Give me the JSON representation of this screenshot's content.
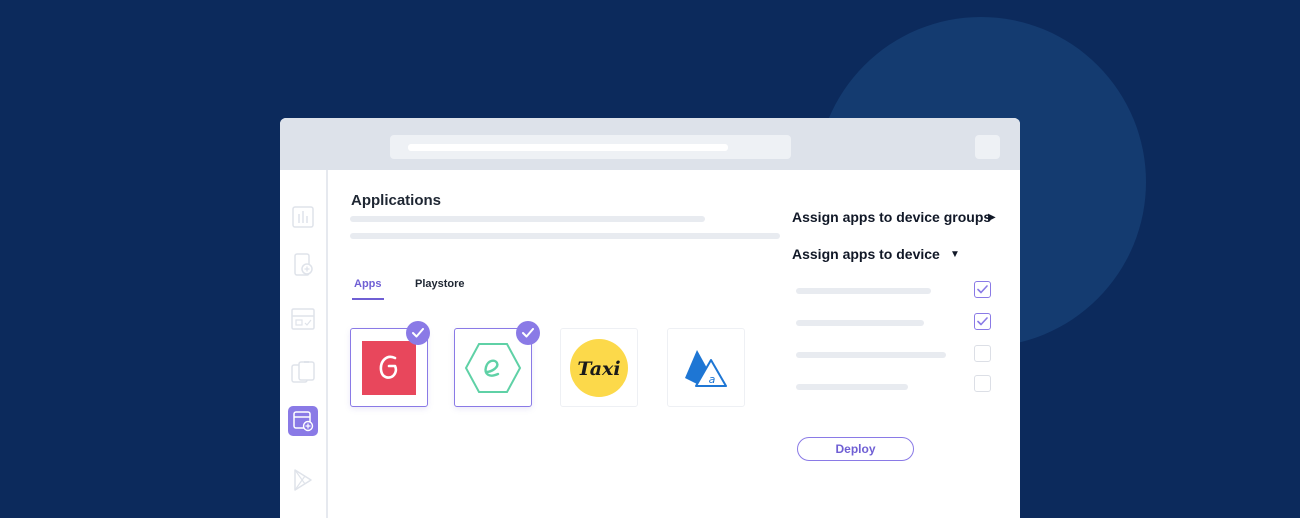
{
  "main": {
    "title": "Applications",
    "tabs": [
      {
        "label": "Apps",
        "active": true
      },
      {
        "label": "Playstore",
        "active": false
      }
    ],
    "apps": [
      {
        "name": "g-app-logo",
        "letter": "G",
        "selected": true
      },
      {
        "name": "e-app-logo",
        "letter": "e",
        "selected": true
      },
      {
        "name": "taxi-app-logo",
        "letter": "Taxi",
        "selected": false
      },
      {
        "name": "a-app-logo",
        "letter": "a",
        "selected": false
      }
    ]
  },
  "assign": {
    "groups_label": "Assign apps to device groups",
    "device_label": "Assign apps to device",
    "devices": [
      {
        "checked": true
      },
      {
        "checked": true
      },
      {
        "checked": false
      },
      {
        "checked": false
      }
    ],
    "deploy_label": "Deploy"
  },
  "sidebar": {
    "items": [
      {
        "icon": "bar-chart-icon"
      },
      {
        "icon": "device-add-icon"
      },
      {
        "icon": "layout-icon"
      },
      {
        "icon": "devices-icon"
      },
      {
        "icon": "app-add-icon",
        "active": true
      },
      {
        "icon": "play-store-icon"
      }
    ]
  },
  "colors": {
    "background": "#0c2a5c",
    "accent": "#8a7ae6",
    "g_app": "#e8475c",
    "e_app": "#5fd1a6",
    "taxi_app": "#fcd94a",
    "a_app": "#1e76d4"
  }
}
